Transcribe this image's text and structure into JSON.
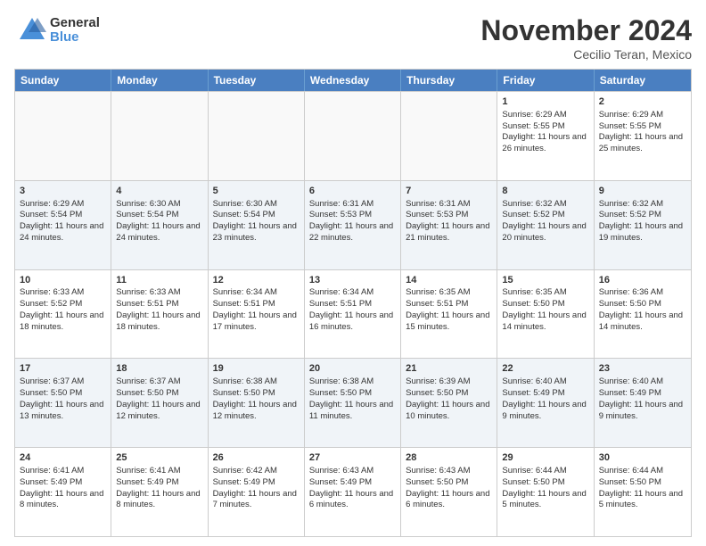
{
  "logo": {
    "general": "General",
    "blue": "Blue"
  },
  "header": {
    "month": "November 2024",
    "location": "Cecilio Teran, Mexico"
  },
  "days": [
    "Sunday",
    "Monday",
    "Tuesday",
    "Wednesday",
    "Thursday",
    "Friday",
    "Saturday"
  ],
  "rows": [
    [
      {
        "day": "",
        "info": "",
        "empty": true
      },
      {
        "day": "",
        "info": "",
        "empty": true
      },
      {
        "day": "",
        "info": "",
        "empty": true
      },
      {
        "day": "",
        "info": "",
        "empty": true
      },
      {
        "day": "",
        "info": "",
        "empty": true
      },
      {
        "day": "1",
        "info": "Sunrise: 6:29 AM\nSunset: 5:55 PM\nDaylight: 11 hours and 26 minutes."
      },
      {
        "day": "2",
        "info": "Sunrise: 6:29 AM\nSunset: 5:55 PM\nDaylight: 11 hours and 25 minutes."
      }
    ],
    [
      {
        "day": "3",
        "info": "Sunrise: 6:29 AM\nSunset: 5:54 PM\nDaylight: 11 hours and 24 minutes."
      },
      {
        "day": "4",
        "info": "Sunrise: 6:30 AM\nSunset: 5:54 PM\nDaylight: 11 hours and 24 minutes."
      },
      {
        "day": "5",
        "info": "Sunrise: 6:30 AM\nSunset: 5:54 PM\nDaylight: 11 hours and 23 minutes."
      },
      {
        "day": "6",
        "info": "Sunrise: 6:31 AM\nSunset: 5:53 PM\nDaylight: 11 hours and 22 minutes."
      },
      {
        "day": "7",
        "info": "Sunrise: 6:31 AM\nSunset: 5:53 PM\nDaylight: 11 hours and 21 minutes."
      },
      {
        "day": "8",
        "info": "Sunrise: 6:32 AM\nSunset: 5:52 PM\nDaylight: 11 hours and 20 minutes."
      },
      {
        "day": "9",
        "info": "Sunrise: 6:32 AM\nSunset: 5:52 PM\nDaylight: 11 hours and 19 minutes."
      }
    ],
    [
      {
        "day": "10",
        "info": "Sunrise: 6:33 AM\nSunset: 5:52 PM\nDaylight: 11 hours and 18 minutes."
      },
      {
        "day": "11",
        "info": "Sunrise: 6:33 AM\nSunset: 5:51 PM\nDaylight: 11 hours and 18 minutes."
      },
      {
        "day": "12",
        "info": "Sunrise: 6:34 AM\nSunset: 5:51 PM\nDaylight: 11 hours and 17 minutes."
      },
      {
        "day": "13",
        "info": "Sunrise: 6:34 AM\nSunset: 5:51 PM\nDaylight: 11 hours and 16 minutes."
      },
      {
        "day": "14",
        "info": "Sunrise: 6:35 AM\nSunset: 5:51 PM\nDaylight: 11 hours and 15 minutes."
      },
      {
        "day": "15",
        "info": "Sunrise: 6:35 AM\nSunset: 5:50 PM\nDaylight: 11 hours and 14 minutes."
      },
      {
        "day": "16",
        "info": "Sunrise: 6:36 AM\nSunset: 5:50 PM\nDaylight: 11 hours and 14 minutes."
      }
    ],
    [
      {
        "day": "17",
        "info": "Sunrise: 6:37 AM\nSunset: 5:50 PM\nDaylight: 11 hours and 13 minutes."
      },
      {
        "day": "18",
        "info": "Sunrise: 6:37 AM\nSunset: 5:50 PM\nDaylight: 11 hours and 12 minutes."
      },
      {
        "day": "19",
        "info": "Sunrise: 6:38 AM\nSunset: 5:50 PM\nDaylight: 11 hours and 12 minutes."
      },
      {
        "day": "20",
        "info": "Sunrise: 6:38 AM\nSunset: 5:50 PM\nDaylight: 11 hours and 11 minutes."
      },
      {
        "day": "21",
        "info": "Sunrise: 6:39 AM\nSunset: 5:50 PM\nDaylight: 11 hours and 10 minutes."
      },
      {
        "day": "22",
        "info": "Sunrise: 6:40 AM\nSunset: 5:49 PM\nDaylight: 11 hours and 9 minutes."
      },
      {
        "day": "23",
        "info": "Sunrise: 6:40 AM\nSunset: 5:49 PM\nDaylight: 11 hours and 9 minutes."
      }
    ],
    [
      {
        "day": "24",
        "info": "Sunrise: 6:41 AM\nSunset: 5:49 PM\nDaylight: 11 hours and 8 minutes."
      },
      {
        "day": "25",
        "info": "Sunrise: 6:41 AM\nSunset: 5:49 PM\nDaylight: 11 hours and 8 minutes."
      },
      {
        "day": "26",
        "info": "Sunrise: 6:42 AM\nSunset: 5:49 PM\nDaylight: 11 hours and 7 minutes."
      },
      {
        "day": "27",
        "info": "Sunrise: 6:43 AM\nSunset: 5:49 PM\nDaylight: 11 hours and 6 minutes."
      },
      {
        "day": "28",
        "info": "Sunrise: 6:43 AM\nSunset: 5:50 PM\nDaylight: 11 hours and 6 minutes."
      },
      {
        "day": "29",
        "info": "Sunrise: 6:44 AM\nSunset: 5:50 PM\nDaylight: 11 hours and 5 minutes."
      },
      {
        "day": "30",
        "info": "Sunrise: 6:44 AM\nSunset: 5:50 PM\nDaylight: 11 hours and 5 minutes."
      }
    ]
  ]
}
